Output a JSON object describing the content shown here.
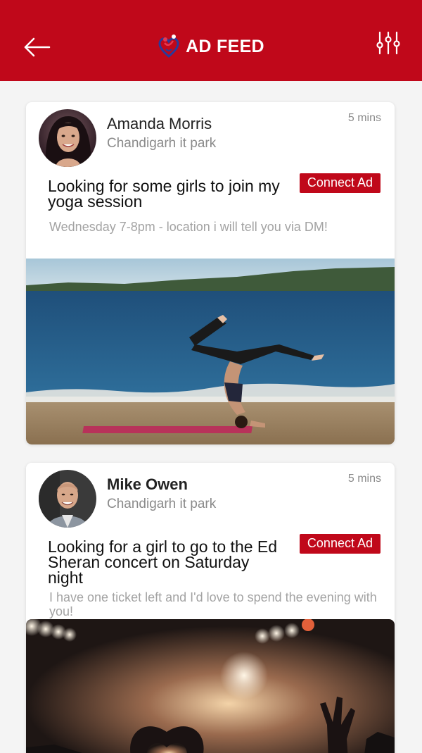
{
  "header": {
    "title": "AD FEED",
    "back_icon": "arrow-left-icon",
    "filter_icon": "sliders-icon",
    "logo_icon": "heart-couple-logo"
  },
  "colors": {
    "brand": "#c0081a",
    "background": "#f4f4f4",
    "muted_text": "#8a8a8a"
  },
  "posts": [
    {
      "name": "Amanda Morris",
      "location": "Chandigarh it park",
      "time": "5 mins",
      "headline": "Looking for some girls to join my yoga session",
      "connect_label": "Connect Ad",
      "description": "Wednesday 7-8pm - location i will tell you via DM!",
      "photo": "yoga-on-beach-photo"
    },
    {
      "name": "Mike Owen",
      "location": "Chandigarh it park",
      "time": "5 mins",
      "headline": "Looking for a girl to go to the Ed Sheran concert on Saturday night",
      "connect_label": "Connect Ad",
      "description": "I have one ticket left and I'd love to spend the evening with you!",
      "photo": "concert-crowd-photo"
    }
  ]
}
